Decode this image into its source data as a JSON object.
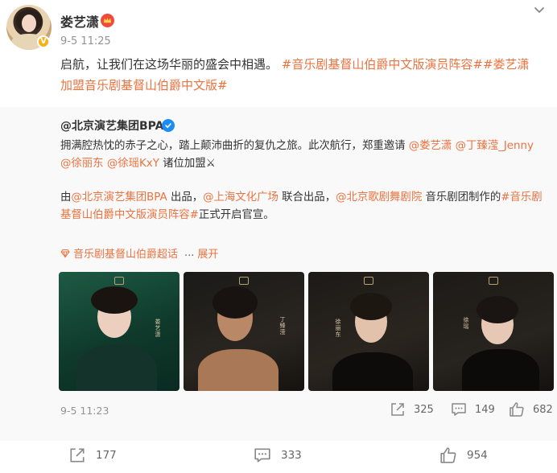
{
  "post": {
    "username": "娄艺潇",
    "time": "9-5 11:25",
    "text_intro": "启航，让我们在这场华丽的盛会中相遇。",
    "hashtag_1": "#音乐剧基督山伯爵中文版演员阵容#",
    "hashtag_2_part1": "#娄艺潇",
    "hashtag_2_part2": "加盟音乐剧基督山伯爵中文版#"
  },
  "retweet": {
    "author": "@北京演艺集团BPA",
    "line1_text": "拥满腔热忱的赤子之心，踏上颠沛曲折的复仇之旅。此次航行，郑重邀请 ",
    "mention_1": "@娄艺潇",
    "mention_2": "@丁臻滢_Jenny",
    "mention_3": "@徐丽东",
    "mention_4": "@徐瑶KxY",
    "line2_suffix": " 诸位加盟⚔",
    "p2_prefix": "由",
    "p2_mention_1": "@北京演艺集团BPA",
    "p2_text_1": " 出品，",
    "p2_mention_2": "@上海文化广场",
    "p2_text_2": " 联合出品，",
    "p2_mention_3": "@北京歌剧舞剧院",
    "p2_text_3": " 音乐剧团制作的",
    "p2_hashtag": "#音乐剧基督山伯爵中文版演员阵容#",
    "p2_text_4": "正式开启官宣。",
    "supertopic_label": "音乐剧基督山伯爵超话",
    "ellipsis": "...",
    "expand_label": "展开",
    "photo_names": [
      "娄艺潇",
      "丁臻滢",
      "徐丽东",
      "徐瑶"
    ],
    "time": "9-5 11:23",
    "repost_count": "325",
    "comment_count": "149",
    "like_count": "682"
  },
  "actions": {
    "repost_count": "177",
    "comment_count": "333",
    "like_count": "954"
  },
  "colors": {
    "accent": "#eb7340",
    "muted": "#939393",
    "retweet_bg": "#f9f9f9"
  },
  "icons": [
    "chevron-down-icon",
    "vip-crown-icon",
    "verified-icon",
    "supertopic-icon",
    "repost-icon",
    "comment-icon",
    "like-icon"
  ]
}
